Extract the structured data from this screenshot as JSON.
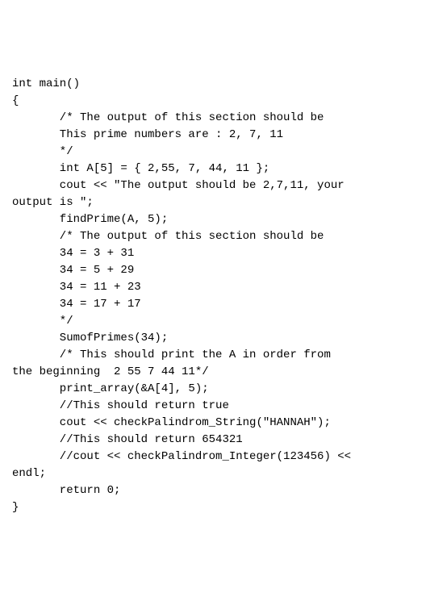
{
  "code": {
    "lines": [
      "int main()",
      "{",
      "       /* The output of this section should be",
      "       This prime numbers are : 2, 7, 11",
      "       */",
      "       int A[5] = { 2,55, 7, 44, 11 };",
      "       cout << \"The output should be 2,7,11, your",
      "output is \";",
      "       findPrime(A, 5);",
      "",
      "",
      "       /* The output of this section should be",
      "       34 = 3 + 31",
      "       34 = 5 + 29",
      "       34 = 11 + 23",
      "       34 = 17 + 17",
      "       */",
      "       SumofPrimes(34);",
      "",
      "",
      "",
      "       /* This should print the A in order from",
      "the beginning  2 55 7 44 11*/",
      "       print_array(&A[4], 5);",
      "",
      "",
      "",
      "       //This should return true",
      "       cout << checkPalindrom_String(\"HANNAH\");",
      "",
      "",
      "       //This should return 654321",
      "       //cout << checkPalindrom_Integer(123456) <<",
      "endl;",
      "",
      "       return 0;",
      "}"
    ]
  }
}
